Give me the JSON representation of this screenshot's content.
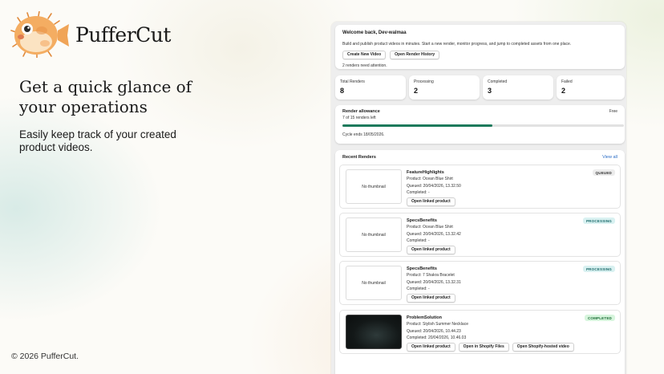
{
  "brand": {
    "name": "PufferCut"
  },
  "hero": {
    "headline": "Get a quick glance of your operations",
    "subline": "Easily keep track of your created product videos."
  },
  "footer": {
    "copyright": "© 2026 PufferCut."
  },
  "welcome": {
    "title": "Welcome back, Dev-walmaa",
    "description": "Build and publish product videos in minutes. Start a new render, monitor progress, and jump to completed assets from one place.",
    "create_label": "Create New Video",
    "history_label": "Open Render History",
    "attention": "2 renders need attention."
  },
  "stats": [
    {
      "label": "Total Renders",
      "value": "8"
    },
    {
      "label": "Processing",
      "value": "2"
    },
    {
      "label": "Completed",
      "value": "3"
    },
    {
      "label": "Failed",
      "value": "2"
    }
  ],
  "allowance": {
    "title": "Render allowance",
    "plan": "Free",
    "left_text": "7 of 15 renders left",
    "used_fraction": 0.533,
    "cycle": "Cycle ends 18/05/2026."
  },
  "recent": {
    "title": "Recent Renders",
    "view_all": "View all",
    "items": [
      {
        "title": "FeatureHighlights",
        "thumb": "No thumbnail",
        "product": "Product: Ocean Blue Shirt",
        "queued": "Queued: 20/04/2026, 13.32.50",
        "completed": "Completed: -",
        "status": "QUEUED",
        "btn1": "Open linked product"
      },
      {
        "title": "SpecsBenefits",
        "thumb": "No thumbnail",
        "product": "Product: Ocean Blue Shirt",
        "queued": "Queued: 20/04/2026, 13.32.42",
        "completed": "Completed: -",
        "status": "PROCESSING",
        "btn1": "Open linked product"
      },
      {
        "title": "SpecsBenefits",
        "thumb": "No thumbnail",
        "product": "Product: 7 Shakra Bracelet",
        "queued": "Queued: 20/04/2026, 13.32.31",
        "completed": "Completed: -",
        "status": "PROCESSING",
        "btn1": "Open linked product"
      },
      {
        "title": "ProblemSolution",
        "product": "Product: Stylish Summer Necklace",
        "queued": "Queued: 20/04/2026, 10.44.23",
        "completed": "Completed: 20/04/2026, 10.46.03",
        "status": "COMPLETED",
        "btn1": "Open linked product",
        "btn2": "Open in Shopify Files",
        "btn3": "Open Shopify-hosted video"
      }
    ]
  },
  "colors": {
    "accent": "#1d7a5c",
    "link": "#2a6cc6"
  }
}
